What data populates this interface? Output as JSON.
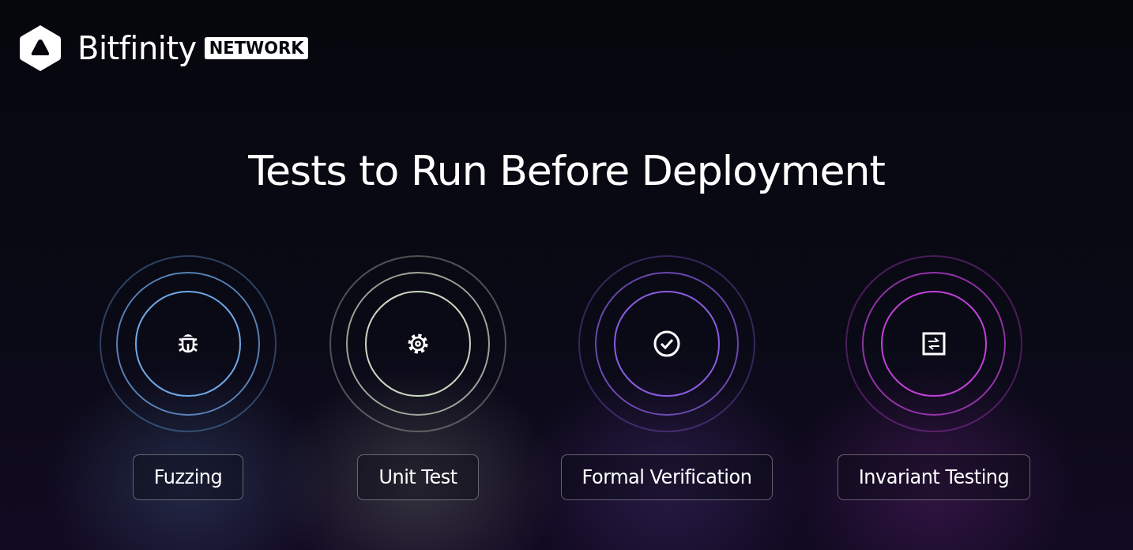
{
  "brand": {
    "name": "Bitfinity",
    "badge": "NETWORK"
  },
  "title": "Tests to Run Before Deployment",
  "tests": [
    {
      "label": "Fuzzing",
      "kind": "bug",
      "color": "#6fa8e8"
    },
    {
      "label": "Unit Test",
      "kind": "gear",
      "color": "#c9d8c0"
    },
    {
      "label": "Formal Verification",
      "kind": "check",
      "color": "#8a5ce0"
    },
    {
      "label": "Invariant Testing",
      "kind": "swap",
      "color": "#c040d8"
    }
  ]
}
